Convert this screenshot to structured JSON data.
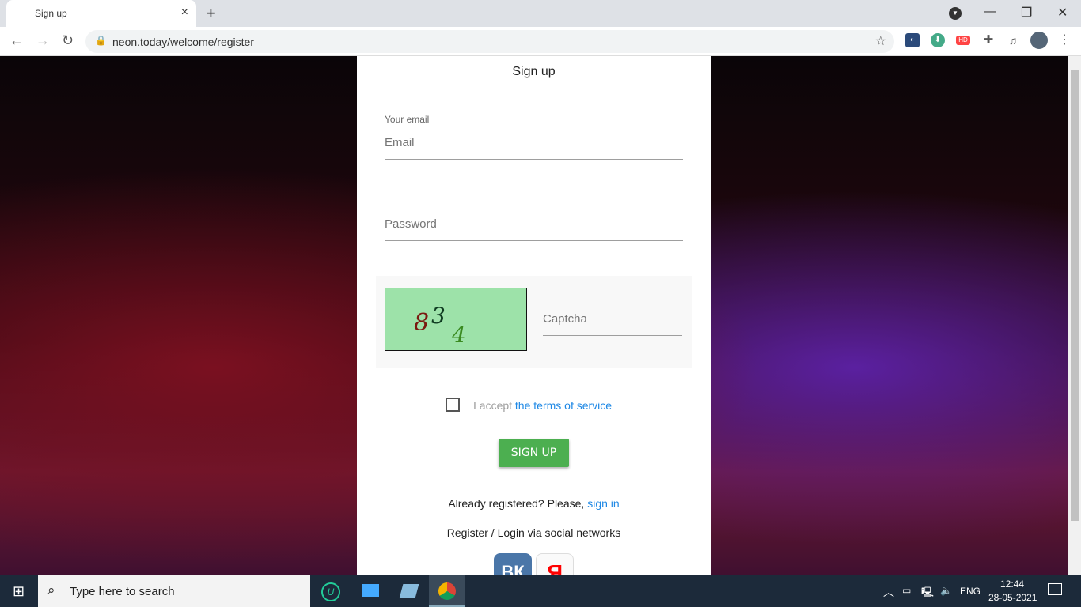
{
  "browser": {
    "tab_title": "Sign up",
    "url": "neon.today/welcome/register"
  },
  "form": {
    "title": "Sign up",
    "email_label": "Your email",
    "email_placeholder": "Email",
    "password_placeholder": "Password",
    "captcha_digits": [
      "8",
      "3",
      "4"
    ],
    "captcha_placeholder": "Captcha",
    "accept_text": "I accept",
    "terms_link": "the terms of service",
    "signup_label": "SIGN UP",
    "already_text": "Already registered? Please,",
    "signin_link": "sign in",
    "social_text": "Register / Login via social networks",
    "vk_label": "ВК",
    "yandex_label": "Я"
  },
  "colors": {
    "accent": "#1e88e5",
    "button": "#4caf50",
    "vk": "#4a76a8",
    "yandex": "#ff0000"
  },
  "taskbar": {
    "search_placeholder": "Type here to search",
    "lang": "ENG",
    "time": "12:44",
    "date": "28-05-2021"
  }
}
